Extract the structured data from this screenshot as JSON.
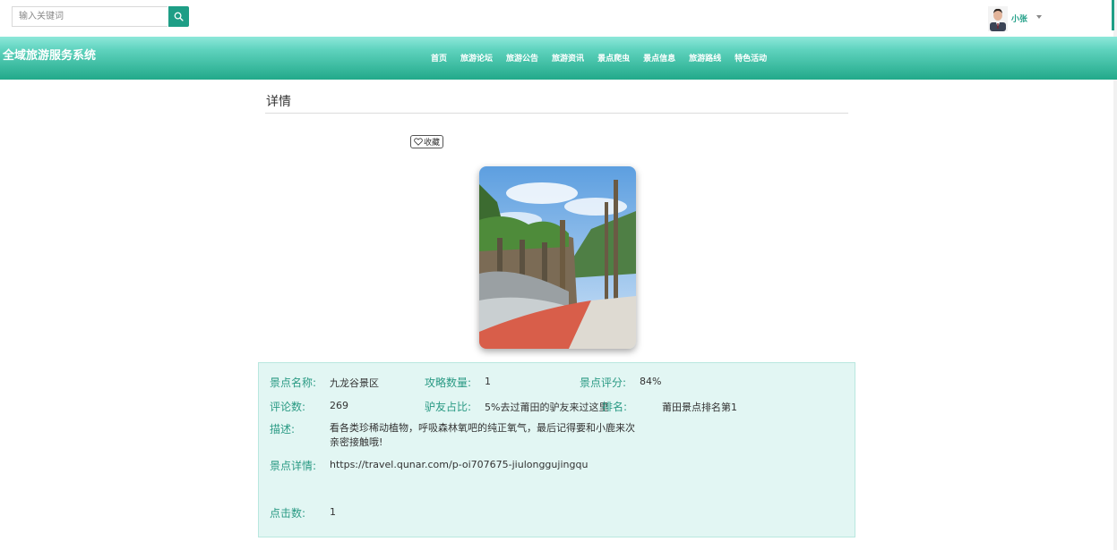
{
  "search": {
    "placeholder": "输入关键词"
  },
  "user": {
    "name": "小张"
  },
  "header": {
    "brand": "全域旅游服务系统",
    "nav": [
      "首页",
      "旅游论坛",
      "旅游公告",
      "旅游资讯",
      "景点爬虫",
      "景点信息",
      "旅游路线",
      "特色活动"
    ]
  },
  "detail": {
    "title": "详情",
    "favorite_label": "收藏",
    "fields": {
      "name_label": "景点名称:",
      "name_value": "九龙谷景区",
      "guides_label": "攻略数量:",
      "guides_value": "1",
      "score_label": "景点评分:",
      "score_value": "84%",
      "comments_label": "评论数:",
      "comments_value": "269",
      "ratio_label": "驴友占比:",
      "ratio_value": "5%去过莆田的驴友来过这里",
      "rank_label": "排名:",
      "rank_value": "莆田景点排名第1",
      "desc_label": "描述:",
      "desc_value": "看各类珍稀动植物，呼吸森林氧吧的纯正氧气，最后记得要和小鹿来次亲密接触哦!",
      "url_label": "景点详情:",
      "url_value": "https://travel.qunar.com/p-oi707675-jiulonggujingqu",
      "clicks_label": "点击数:",
      "clicks_value": "1"
    }
  },
  "colors": {
    "accent": "#1e9e86",
    "label": "#2a9a84",
    "panel_bg": "#e2f6f3"
  },
  "icons": {
    "search": "search-icon",
    "favorite": "heart-icon",
    "dropdown": "caret-down-icon"
  }
}
